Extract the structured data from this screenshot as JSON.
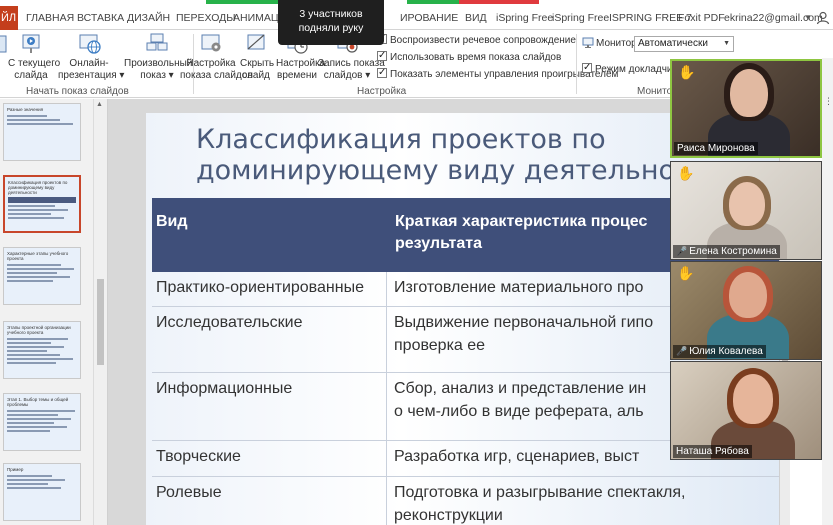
{
  "tabs": {
    "file": "ЙЛ",
    "items": [
      "ГЛАВНАЯ",
      "ВСТАВКА",
      "ДИЗАЙН",
      "ПЕРЕХОДЫ",
      "АНИМАЦИ",
      "ИРОВАНИЕ",
      "ВИД",
      "iSpring Free",
      "iSpring Free",
      "ISPRING FREE 7",
      "Foxit PDF"
    ],
    "account": "ekrina22@gmail.com"
  },
  "toast": {
    "text": "3 участников подняли руку"
  },
  "ribbon": {
    "buttons": [
      {
        "label1": "С текущего",
        "label2": "слайда",
        "icon": "slide-play-icon"
      },
      {
        "label1": "Онлайн-",
        "label2": "презентация ▾",
        "icon": "globe-icon"
      },
      {
        "label1": "Произвольный",
        "label2": "показ ▾",
        "icon": "custom-show-icon"
      },
      {
        "label1": "Настройка",
        "label2": "показа слайдов",
        "icon": "setup-show-icon"
      },
      {
        "label1": "Скрыть",
        "label2": "слайд",
        "icon": "hide-slide-icon"
      },
      {
        "label1": "Настройка",
        "label2": "времени",
        "icon": "timer-icon"
      },
      {
        "label1": "Запись показа",
        "label2": "слайдов ▾",
        "icon": "record-icon"
      }
    ],
    "group_start": "Начать показ слайдов",
    "group_setup": "Настройка",
    "group_monitors": "Монитор",
    "checkboxes": [
      {
        "label": "Воспроизвести речевое сопровождение",
        "checked": true
      },
      {
        "label": "Использовать время показа слайдов",
        "checked": true
      },
      {
        "label": "Показать элементы управления проигрывателем",
        "checked": true
      }
    ],
    "monitor_label": "Монитор:",
    "monitor_value": "Автоматически",
    "presenter_label": "Режим докладчика",
    "presenter_checked": true
  },
  "thumbnails": [
    {
      "title": "Разные значения",
      "lines": 3
    },
    {
      "title": "Классификация проектов по доминирующему виду деятельности",
      "lines": 4
    },
    {
      "title": "Характерные этапы учебного проекта",
      "lines": 5
    },
    {
      "title": "Этапы проектной организации учебного проекта",
      "lines": 7
    },
    {
      "title": "Этап 1. Выбор темы и общей проблемы",
      "lines": 6
    },
    {
      "title": "Пример",
      "lines": 4
    }
  ],
  "slide": {
    "title_line1": "Классификация проектов по",
    "title_line2": "доминирующему виду деятельност",
    "header": {
      "col1": "Вид",
      "col2_line1": "Краткая характеристика процес",
      "col2_line2": "результата"
    },
    "rows": [
      {
        "type": "Практико-ориентированные",
        "desc1": "Изготовление материального про",
        "desc2": ""
      },
      {
        "type": "Исследовательские",
        "desc1": "Выдвижение первоначальной гипо",
        "desc2": "проверка ее"
      },
      {
        "type": "Информационные",
        "desc1": "Сбор, анализ и представление ин",
        "desc2": "о чем-либо в виде реферата, аль"
      },
      {
        "type": "Творческие",
        "desc1": "Разработка игр, сценариев, выст",
        "desc2": ""
      },
      {
        "type": "Ролевые",
        "desc1": "Подготовка и разыгрывание спектакля,",
        "desc2": "реконструкции"
      }
    ]
  },
  "participants": [
    {
      "name": "Раиса Миронова",
      "hand": true,
      "muted": false,
      "speaking": true
    },
    {
      "name": "Елена Костромина",
      "hand": true,
      "muted": true,
      "speaking": false
    },
    {
      "name": "Юлия Ковалева",
      "hand": true,
      "muted": true,
      "speaking": false
    },
    {
      "name": "Наташа Рябова",
      "hand": false,
      "muted": false,
      "speaking": false
    }
  ]
}
